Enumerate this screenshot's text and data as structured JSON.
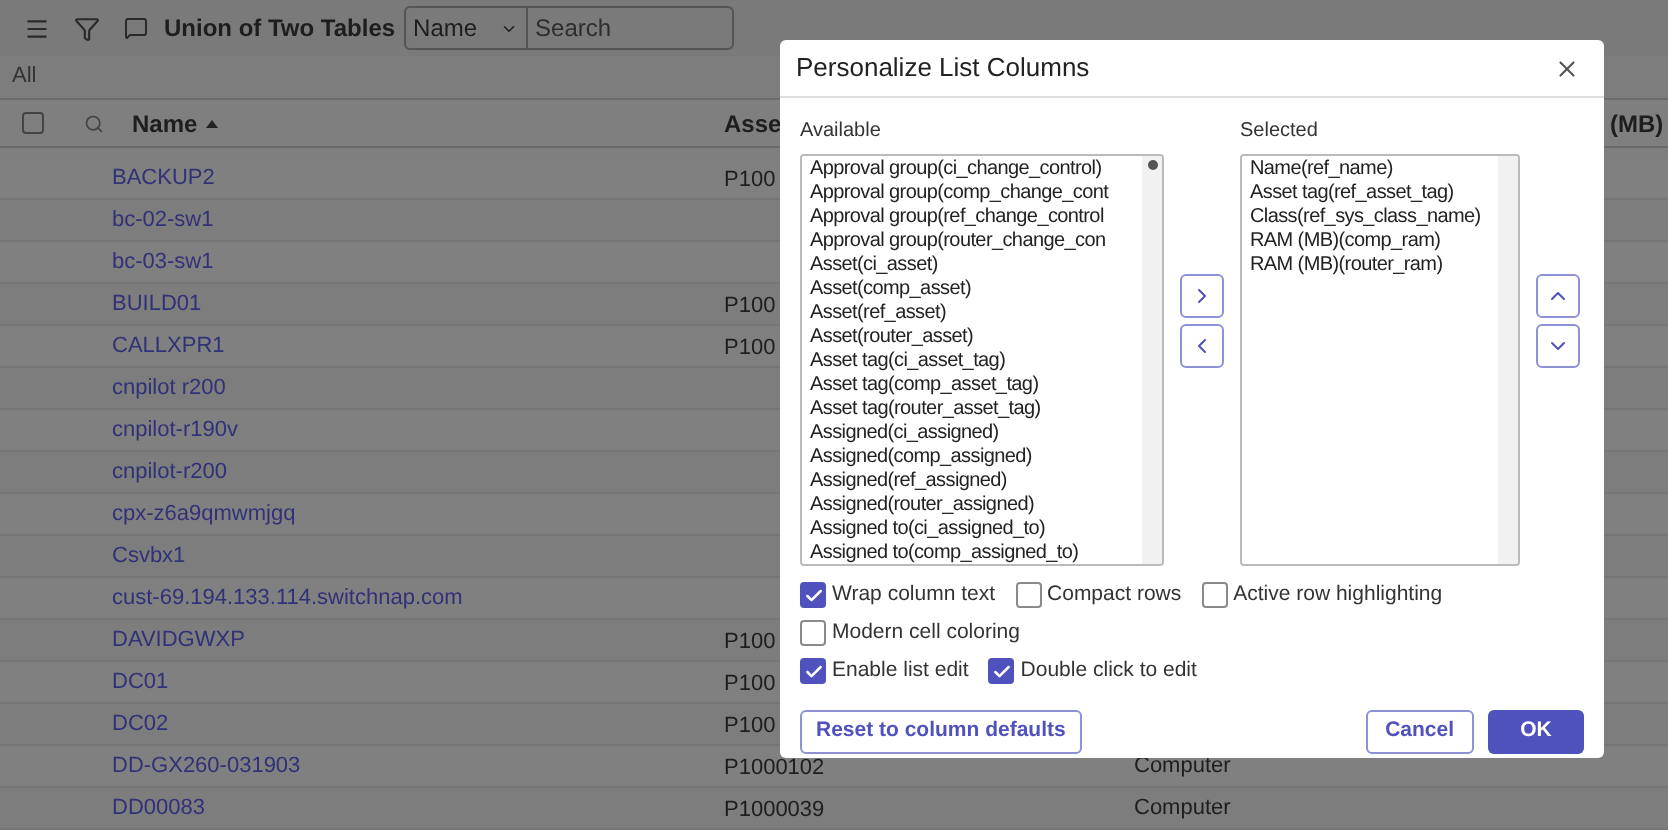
{
  "toolbar": {
    "title": "Union of Two Tables",
    "search_field_select": "Name",
    "search": {
      "placeholder": "Search"
    }
  },
  "breadcrumb": "All",
  "table": {
    "select_all_checked": false,
    "columns": [
      {
        "label": "Name",
        "sorted": true
      },
      {
        "label": "Asse",
        "sorted": false
      },
      {
        "label": "(MB)",
        "sorted": false
      }
    ],
    "rows": [
      {
        "name": "BACKUP2",
        "asset": "P100",
        "class": ""
      },
      {
        "name": "bc-02-sw1",
        "asset": "",
        "class": ""
      },
      {
        "name": "bc-03-sw1",
        "asset": "",
        "class": ""
      },
      {
        "name": "BUILD01",
        "asset": "P100",
        "class": ""
      },
      {
        "name": "CALLXPR1",
        "asset": "P100",
        "class": ""
      },
      {
        "name": "cnpilot r200",
        "asset": "",
        "class": ""
      },
      {
        "name": "cnpilot-r190v",
        "asset": "",
        "class": ""
      },
      {
        "name": "cnpilot-r200",
        "asset": "",
        "class": ""
      },
      {
        "name": "cpx-z6a9qmwmjgq",
        "asset": "",
        "class": ""
      },
      {
        "name": "Csvbx1",
        "asset": "",
        "class": ""
      },
      {
        "name": "cust-69.194.133.114.switchnap.com",
        "asset": "",
        "class": ""
      },
      {
        "name": "DAVIDGWXP",
        "asset": "P100",
        "class": ""
      },
      {
        "name": "DC01",
        "asset": "P100",
        "class": ""
      },
      {
        "name": "DC02",
        "asset": "P100",
        "class": ""
      },
      {
        "name": "DD-GX260-031903",
        "asset": "P1000102",
        "class": "Computer"
      },
      {
        "name": "DD00083",
        "asset": "P1000039",
        "class": "Computer"
      }
    ]
  },
  "dialog": {
    "title": "Personalize List Columns",
    "available": {
      "label": "Available",
      "items": [
        "Approval group(ci_change_control)",
        "Approval group(comp_change_cont",
        "Approval group(ref_change_control",
        "Approval group(router_change_con",
        "Asset(ci_asset)",
        "Asset(comp_asset)",
        "Asset(ref_asset)",
        "Asset(router_asset)",
        "Asset tag(ci_asset_tag)",
        "Asset tag(comp_asset_tag)",
        "Asset tag(router_asset_tag)",
        "Assigned(ci_assigned)",
        "Assigned(comp_assigned)",
        "Assigned(ref_assigned)",
        "Assigned(router_assigned)",
        "Assigned to(ci_assigned_to)",
        "Assigned to(comp_assigned_to)"
      ]
    },
    "selected": {
      "label": "Selected",
      "items": [
        "Name(ref_name)",
        "Asset tag(ref_asset_tag)",
        "Class(ref_sys_class_name)",
        "RAM (MB)(comp_ram)",
        "RAM (MB)(router_ram)"
      ]
    },
    "options": [
      [
        {
          "label": "Wrap column text",
          "checked": true
        },
        {
          "label": "Compact rows",
          "checked": false
        },
        {
          "label": "Active row highlighting",
          "checked": false
        }
      ],
      [
        {
          "label": "Modern cell coloring",
          "checked": false
        }
      ],
      [
        {
          "label": "Enable list edit",
          "checked": true
        },
        {
          "label": "Double click to edit",
          "checked": true
        }
      ]
    ],
    "reset_button": "Reset to column defaults",
    "cancel_button": "Cancel",
    "ok_button": "OK"
  }
}
